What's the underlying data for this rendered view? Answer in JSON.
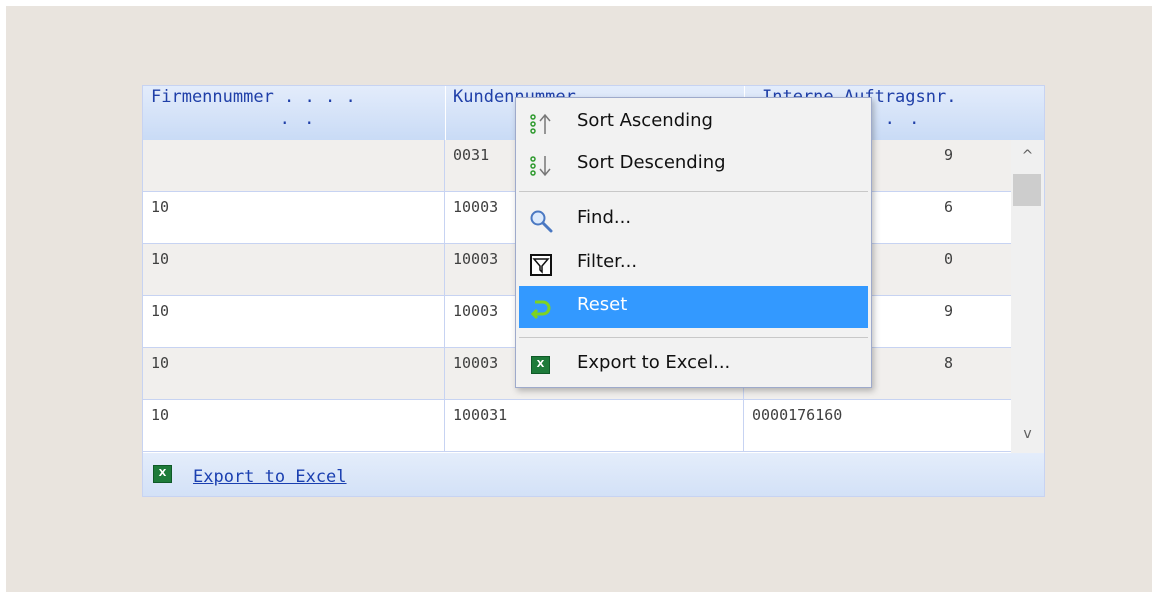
{
  "grid": {
    "columns": [
      {
        "line1": "Firmennummer . . . .",
        "line2": ". ."
      },
      {
        "line1": "Kundennummer",
        "line2": ""
      },
      {
        "line1": "Interne Auftragsnr.",
        "line2": ". ."
      }
    ],
    "rows": [
      [
        "",
        "0031",
        "9"
      ],
      [
        "10",
        "10003",
        "6"
      ],
      [
        "10",
        "10003",
        "0"
      ],
      [
        "10",
        "10003",
        "9"
      ],
      [
        "10",
        "10003",
        "8"
      ],
      [
        "10",
        "100031",
        "0000176160"
      ]
    ],
    "scroll_up": "^",
    "scroll_down": "v"
  },
  "footer": {
    "icon": "excel-icon",
    "icon_text": "X",
    "export_label": "Export to Excel"
  },
  "context_menu": {
    "items": [
      {
        "label": "Sort Ascending",
        "icon": "sort-ascending-icon"
      },
      {
        "label": "Sort Descending",
        "icon": "sort-descending-icon"
      },
      {
        "label": "Find...",
        "icon": "magnifier-icon"
      },
      {
        "label": "Filter...",
        "icon": "filter-icon"
      },
      {
        "label": "Reset",
        "icon": "reset-icon",
        "highlighted": true
      },
      {
        "label": "Export to Excel...",
        "icon": "excel-icon"
      }
    ]
  },
  "colors": {
    "header_text": "#1f3fa8",
    "highlight": "#3399ff",
    "background": "#e9e4de"
  }
}
